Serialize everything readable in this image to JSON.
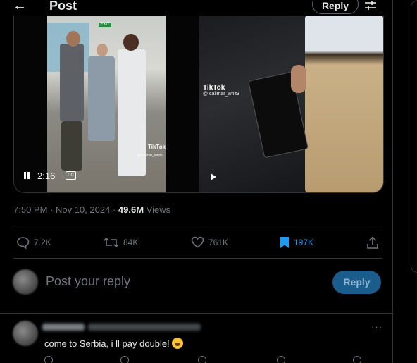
{
  "header": {
    "title": "Post",
    "reply_label": "Reply"
  },
  "video": {
    "time": "2:16",
    "watermark_brand": "TikTok",
    "watermark_handle": "@ calimar_whit3",
    "small_watermark_handle": "@calimar_whit3",
    "exit_sign": "EXIT"
  },
  "post_meta": {
    "time": "7:50 PM",
    "separator": " · ",
    "date": "Nov 10, 2024",
    "dot": " · ",
    "views_count": "49.6M",
    "views_label": " Views"
  },
  "actions": {
    "replies": "7.2K",
    "reposts": "84K",
    "likes": "761K",
    "bookmarks": "197K"
  },
  "reply_box": {
    "placeholder": "Post your reply",
    "button_label": "Reply"
  },
  "comment": {
    "text": "come to Serbia, i ll pay double! ",
    "more": "···"
  },
  "colors": {
    "background": "#000000",
    "accent": "#1d9bf0",
    "muted": "#71767b",
    "border": "#2f3336"
  }
}
